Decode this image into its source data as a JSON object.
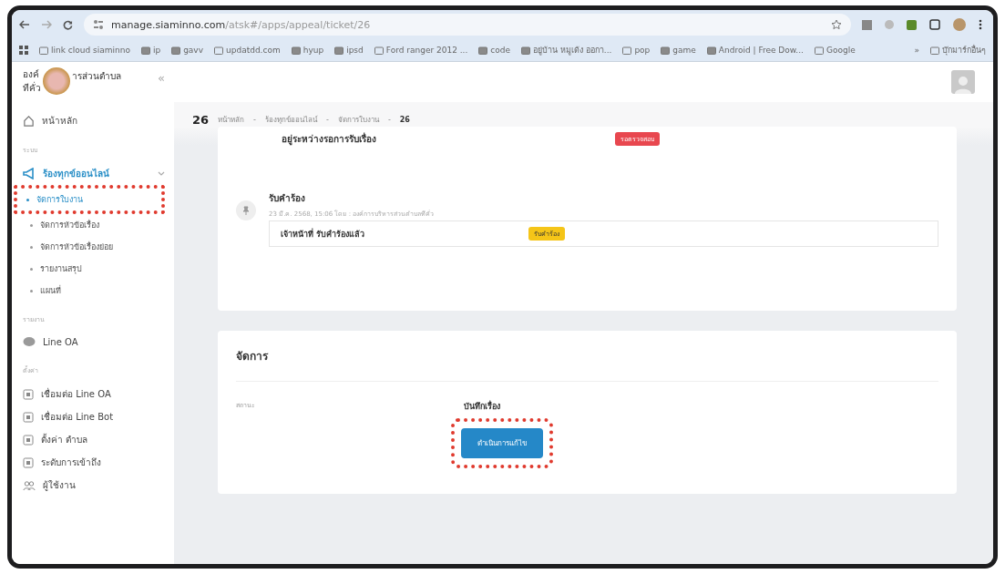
{
  "browser": {
    "address": {
      "host": "manage.siaminno.com",
      "path": "/atsk#/apps/appeal/ticket/26"
    },
    "bookmarks": [
      {
        "label": "link cloud siaminno"
      },
      {
        "label": "ip"
      },
      {
        "label": "gavv"
      },
      {
        "label": "updatdd.com"
      },
      {
        "label": "hyup"
      },
      {
        "label": "ipsd"
      },
      {
        "label": "Ford ranger 2012 ..."
      },
      {
        "label": "code"
      },
      {
        "label": "อยู่บ้าน หมูเด้ง ออกา..."
      },
      {
        "label": "pop"
      },
      {
        "label": "game"
      },
      {
        "label": "Android | Free Dow..."
      },
      {
        "label": "Google"
      }
    ],
    "overflow": "»",
    "other_bookmarks": "บุ๊กมาร์กอื่นๆ"
  },
  "sidebar": {
    "org_name_start": "องค์",
    "org_name_end": "ารส่วนตำบล",
    "org_name_line2": "ทีคั่ว",
    "collapse": "«",
    "sections": [
      {
        "items": [
          {
            "label": "หน้าหลัก"
          }
        ]
      },
      {
        "heading": "ระบบ",
        "items": [
          {
            "label": "ร้องทุกข์ออนไลน์",
            "expanded": true,
            "children": [
              {
                "label": "จัดการใบงาน",
                "selected": true,
                "highlighted": true
              },
              {
                "label": "จัดการหัวข้อเรื่อง",
                "selected": false,
                "highlighted": false
              },
              {
                "label": "จัดการหัวข้อเรื่องย่อย",
                "selected": false,
                "highlighted": false
              },
              {
                "label": "รายงานสรุป",
                "selected": false,
                "highlighted": false
              },
              {
                "label": "แผนที่",
                "selected": false,
                "highlighted": false
              }
            ]
          }
        ]
      },
      {
        "heading": "รายงาน",
        "items": [
          {
            "label": "Line OA"
          }
        ]
      },
      {
        "heading": "ตั้งค่า",
        "items": [
          {
            "label": "เชื่อมต่อ Line OA"
          },
          {
            "label": "เชื่อมต่อ Line Bot"
          },
          {
            "label": "ตั้งค่า ตำบล"
          },
          {
            "label": "ระดับการเข้าถึง"
          },
          {
            "label": "ผู้ใช้งาน"
          }
        ]
      }
    ]
  },
  "main": {
    "page_title": "26",
    "breadcrumb": [
      "หน้าหลัก",
      "ร้องทุกข์ออนไลน์",
      "จัดการใบงาน",
      "26"
    ],
    "breadcrumb_separator": "-",
    "status": {
      "text": "อยู่ระหว่างรอการรับเรื่อง",
      "badge": {
        "label": "รอตรวจสอบ",
        "color": "#e8474f"
      }
    },
    "timeline": [
      {
        "title": "รับคำร้อง",
        "meta": "23 มี.ค. 2568, 15:06 โดย : องค์การบริหารส่วนตำบลทีคั่ว",
        "note": "เจ้าหน้าที่ รับคำร้องแล้ว",
        "badge": {
          "label": "รับคำร้อง",
          "color": "#f5c518"
        }
      }
    ],
    "manage": {
      "title": "จัดการ",
      "field_label": "สถานะ",
      "action_label": "บันทึกเรื่อง",
      "button": {
        "label": "ดำเนินการแก้ไข",
        "highlighted": true
      }
    }
  }
}
